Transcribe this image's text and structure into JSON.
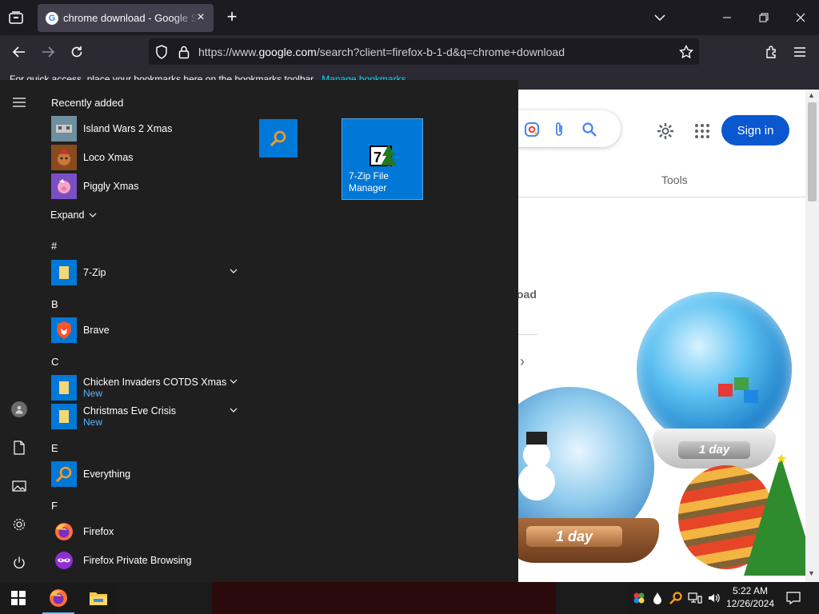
{
  "browser": {
    "tab": {
      "title": "chrome download - Google Search",
      "favicon": "google-g-icon"
    },
    "url": {
      "prefix": "https://www.",
      "host": "google.com",
      "rest": "/search?client=firefox-b-1-d&q=chrome+download"
    },
    "bookmarks_bar": {
      "text": "For quick access, place your bookmarks here on the bookmarks toolbar.",
      "link": "Manage bookmarks..."
    }
  },
  "page": {
    "signin_label": "Sign in",
    "tools_label": "Tools",
    "result_fragment": "oad",
    "doodle": {
      "plaque_right": "1 day",
      "plaque_left": "1 day"
    }
  },
  "start_menu": {
    "recently_added_header": "Recently added",
    "recent": [
      {
        "label": "Island Wars 2 Xmas",
        "icon": "island-wars-icon"
      },
      {
        "label": "Loco Xmas",
        "icon": "loco-xmas-icon"
      },
      {
        "label": "Piggly Xmas",
        "icon": "piggly-xmas-icon"
      }
    ],
    "expand_label": "Expand",
    "groups": {
      "hash": "#",
      "b": "B",
      "c": "C",
      "e": "E",
      "f": "F"
    },
    "apps": {
      "seven_zip": {
        "label": "7-Zip"
      },
      "brave": {
        "label": "Brave"
      },
      "chicken": {
        "label": "Chicken Invaders COTDS Xmas",
        "badge": "New"
      },
      "christmas": {
        "label": "Christmas Eve Crisis",
        "badge": "New"
      },
      "everything": {
        "label": "Everything"
      },
      "firefox": {
        "label": "Firefox"
      },
      "firefox_private": {
        "label": "Firefox Private Browsing"
      }
    },
    "tiles": {
      "small": {
        "icon": "everything-search-icon"
      },
      "medium": {
        "label": "7-Zip File Manager",
        "icon": "7zip-icon"
      }
    }
  },
  "taskbar": {
    "clock_time": "5:22 AM",
    "clock_date": "12/26/2024"
  },
  "colors": {
    "accent_tile": "#0078d7",
    "start_bg": "#1f1f1f",
    "signin_blue": "#0b57d0",
    "new_badge": "#5eb4ff"
  }
}
